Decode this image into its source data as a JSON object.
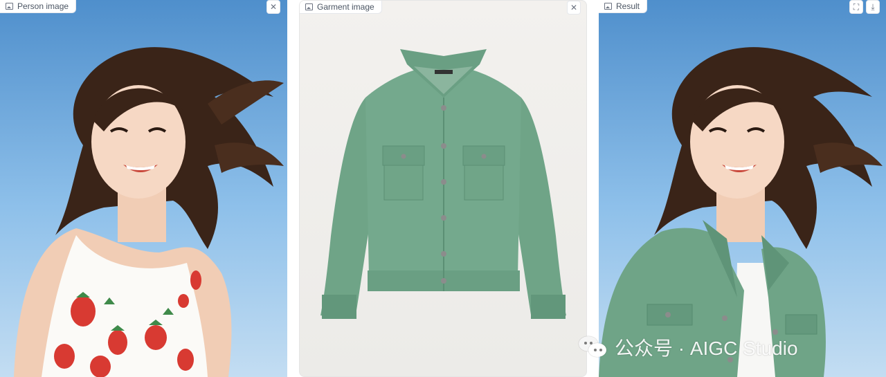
{
  "panels": {
    "person": {
      "label": "Person image",
      "icon": "image-icon"
    },
    "garment": {
      "label": "Garment image",
      "icon": "image-icon"
    },
    "result": {
      "label": "Result",
      "icon": "image-icon"
    }
  },
  "buttons": {
    "clear": "✕",
    "fullscreen": "⛶",
    "download": "⤓"
  },
  "watermark": {
    "text": "公众号 · AIGC Studio"
  },
  "colors": {
    "sky_top": "#4f8fcc",
    "sky_bottom": "#c3ddf2",
    "jacket": "#74a98d",
    "panel_bg": "#f3f1ee"
  }
}
